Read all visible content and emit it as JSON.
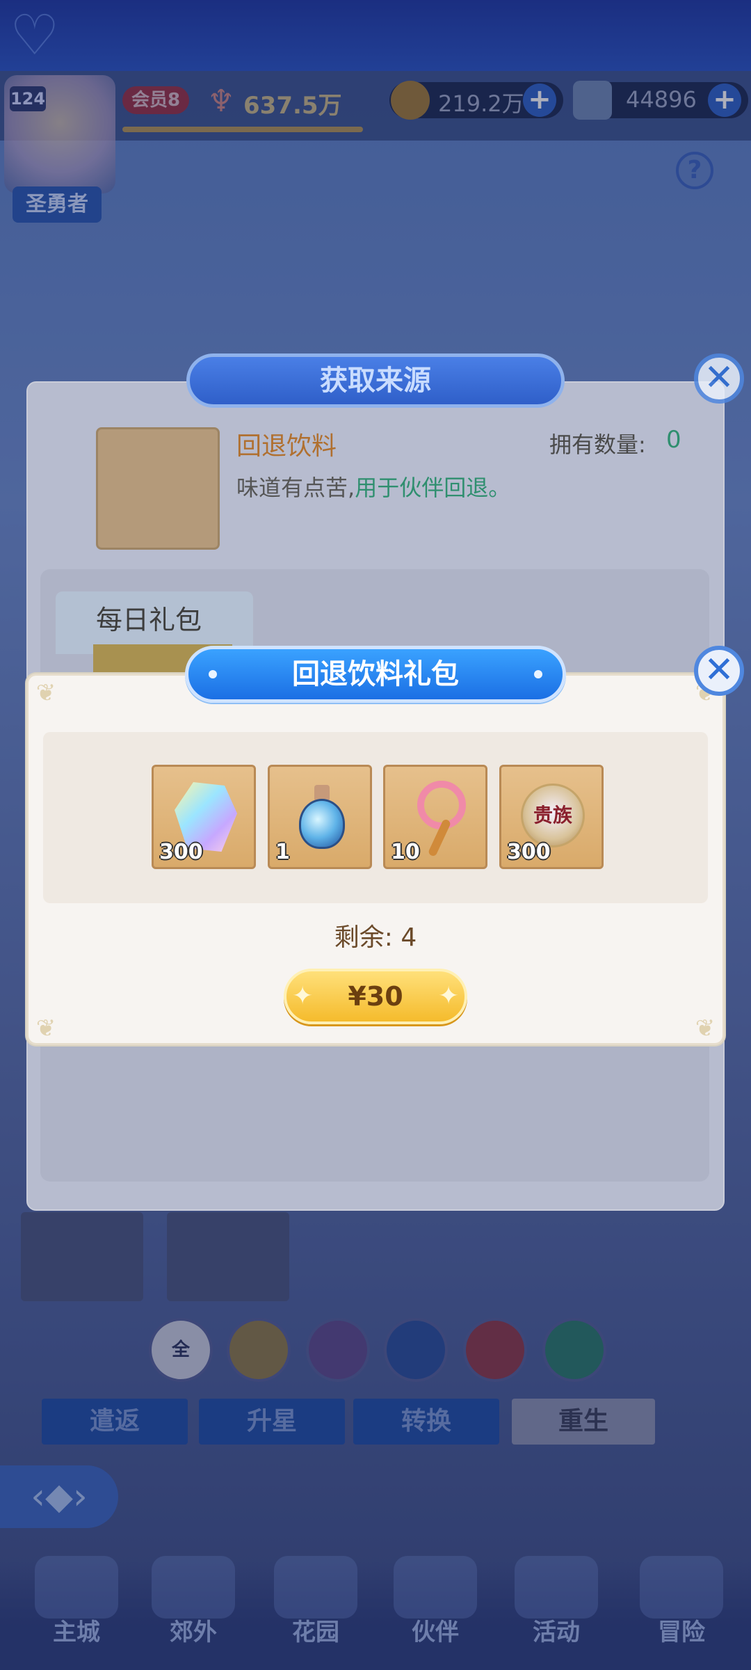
{
  "top_bar": {
    "level": "124",
    "player_title": "圣勇者",
    "vip_label": "会员8",
    "combat_power": "637.5万",
    "gold_amount": "219.2万",
    "gem_amount": "44896",
    "plus_symbol": "+",
    "help_symbol": "?"
  },
  "source_dialog": {
    "title": "获取来源",
    "close_symbol": "✕",
    "item_name": "回退饮料",
    "owned_label": "拥有数量:",
    "owned_value": "0",
    "desc_prefix": "味道有点苦,",
    "desc_highlight": "用于伙伴回退。",
    "daily_pack_label": "每日礼包"
  },
  "gift_dialog": {
    "title": "回退饮料礼包",
    "close_symbol": "✕",
    "rewards": [
      {
        "icon": "crystal-gem-icon",
        "qty": "300"
      },
      {
        "icon": "potion-icon",
        "qty": "1"
      },
      {
        "icon": "magic-wand-icon",
        "qty": "10"
      },
      {
        "icon": "noble-medal-icon",
        "qty": "300",
        "badge_text": "贵族"
      }
    ],
    "remain_label": "剩余:",
    "remain_value": "4",
    "price": "¥30"
  },
  "background": {
    "filter_all_label": "全",
    "tabs": [
      "遣返",
      "升星",
      "转换",
      "重生"
    ],
    "back_symbol": "‹◆›"
  },
  "bottom_nav": {
    "items": [
      "主城",
      "郊外",
      "花园",
      "伙伴",
      "活动",
      "冒险"
    ]
  },
  "colors": {
    "title_bar_blue": "#1b6fe4",
    "buy_button_gold": "#f5bb2c",
    "item_name_orange": "#b07030",
    "highlight_green": "#2f8f6f"
  }
}
